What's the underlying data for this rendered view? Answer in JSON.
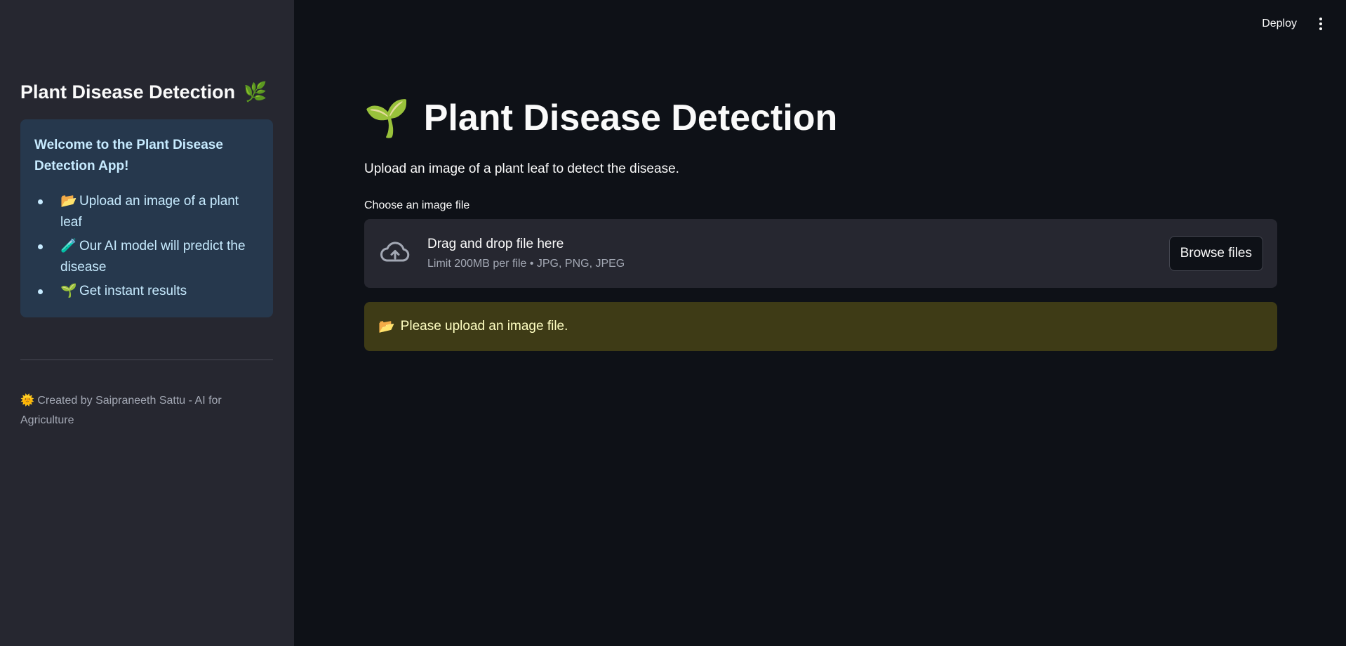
{
  "sidebar": {
    "title": "Plant Disease Detection",
    "title_icon": "🌿",
    "info": {
      "heading": "Welcome to the Plant Disease Detection App!",
      "items": [
        {
          "icon": "📂",
          "text": "Upload an image of a plant leaf"
        },
        {
          "icon": "🧪",
          "text": "Our AI model will predict the disease"
        },
        {
          "icon": "🌱",
          "text": "Get instant results"
        }
      ]
    },
    "footer": {
      "icon": "🌞",
      "text": "Created by Saipraneeth Sattu - AI for Agriculture"
    }
  },
  "header": {
    "deploy_label": "Deploy"
  },
  "main": {
    "title_icon": "🌱",
    "title": "Plant Disease Detection",
    "subtitle": "Upload an image of a plant leaf to detect the disease.",
    "uploader": {
      "label": "Choose an image file",
      "drag_text": "Drag and drop file here",
      "limit_text": "Limit 200MB per file • JPG, PNG, JPEG",
      "browse_label": "Browse files"
    },
    "warning": {
      "icon": "📂",
      "text": "Please upload an image file."
    }
  },
  "colors": {
    "background": "#0e1117",
    "sidebar": "#262730",
    "info_bg": "#26384d",
    "warning_bg": "#3e3b16",
    "warning_text": "#ffffc2"
  }
}
